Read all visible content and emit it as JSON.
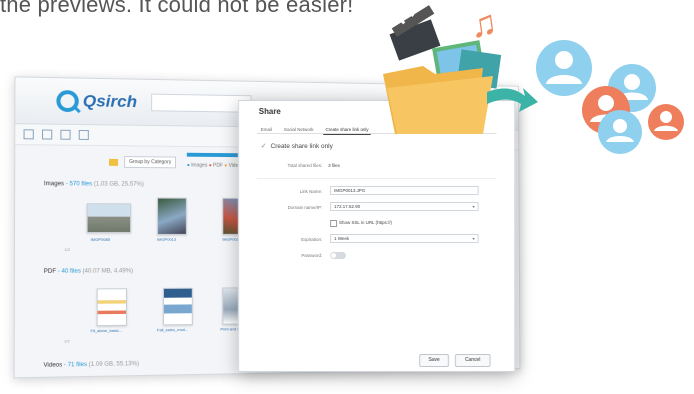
{
  "heading": {
    "text": "the previews. It could not be easier!"
  },
  "app": {
    "name": "Qsirch",
    "group_by_label": "Group by Category",
    "legend": {
      "items": [
        "Images",
        "PDF",
        "Videos"
      ]
    },
    "sections": [
      {
        "title": "Images",
        "count_text": "- 570 files",
        "meta": "(1.03 GB, 25.57%)"
      },
      {
        "title": "PDF",
        "count_text": "- 40 files",
        "meta": "(40.07 MB, 4.49%)"
      },
      {
        "title": "Videos",
        "count_text": "- 71 files",
        "meta": "(1.09 GB, 55.13%)"
      }
    ],
    "thumbs": {
      "images": [
        "IMGP0085",
        "IMGP0013",
        "IMGP0025"
      ],
      "pdf": [
        "Fit_alone_basic...",
        "Fall_sales_mod...",
        "Print and sh..."
      ]
    },
    "list_counter": "1/2"
  },
  "dialog": {
    "title": "Share",
    "tabs": [
      "Email",
      "Social Network",
      "Create share link only"
    ],
    "active_tab": "Create share link only",
    "create_link_label": "Create share link only",
    "total_files_label": "Total shared files:",
    "total_files_value": "3 files",
    "link_name_label": "Link Name:",
    "link_name_value": "IMGP0013.JPG",
    "domain_label": "Domain name/IP:",
    "domain_value": "172.17.62.90",
    "ssl_label": "Show SSL in URL (https://)",
    "expiration_label": "Expiration:",
    "expiration_value": "1 Week",
    "password_label": "Password:",
    "save_label": "Save",
    "cancel_label": "Cancel"
  },
  "colors": {
    "accent_blue": "#2a9ad6",
    "folder_yellow": "#f7c663",
    "note_orange": "#ef8a5e",
    "person_blue": "#8fd0ef",
    "person_orange": "#ef7e5c"
  }
}
